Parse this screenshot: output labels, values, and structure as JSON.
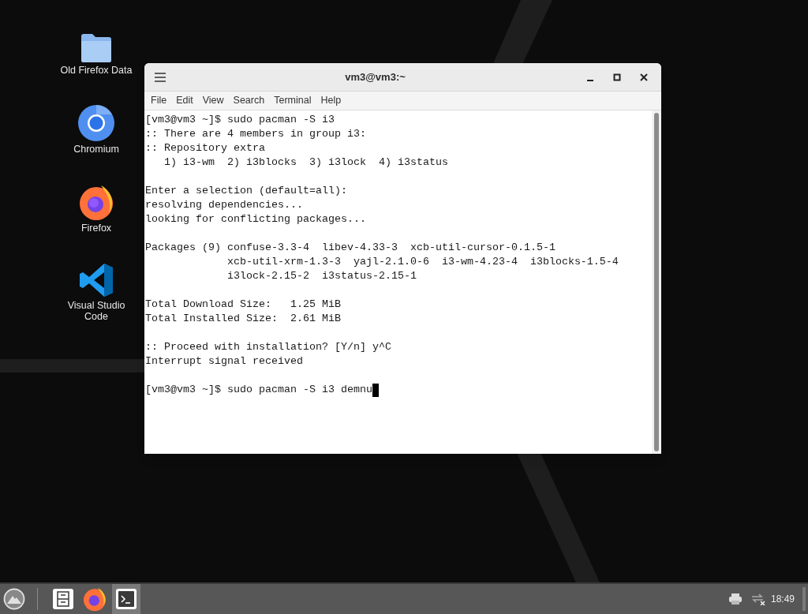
{
  "desktop_icons": [
    {
      "kind": "folder",
      "label": "Old Firefox Data"
    },
    {
      "kind": "chromium",
      "label": "Chromium"
    },
    {
      "kind": "firefox",
      "label": "Firefox"
    },
    {
      "kind": "vscode",
      "label": "Visual Studio Code"
    }
  ],
  "window": {
    "title": "vm3@vm3:~",
    "menu": [
      "File",
      "Edit",
      "View",
      "Search",
      "Terminal",
      "Help"
    ],
    "blocks": [
      [
        "[vm3@vm3 ~]$ sudo pacman -S i3",
        ":: There are 4 members in group i3:",
        ":: Repository extra",
        "   1) i3-wm  2) i3blocks  3) i3lock  4) i3status"
      ],
      [
        "Enter a selection (default=all):",
        "resolving dependencies...",
        "looking for conflicting packages..."
      ],
      [
        "Packages (9) confuse-3.3-4  libev-4.33-3  xcb-util-cursor-0.1.5-1",
        "             xcb-util-xrm-1.3-3  yajl-2.1.0-6  i3-wm-4.23-4  i3blocks-1.5-4",
        "             i3lock-2.15-2  i3status-2.15-1"
      ],
      [
        "Total Download Size:   1.25 MiB",
        "Total Installed Size:  2.61 MiB"
      ],
      [
        ":: Proceed with installation? [Y/n] y^C",
        "Interrupt signal received"
      ],
      [
        "[vm3@vm3 ~]$ sudo pacman -S i3 demnu"
      ]
    ],
    "cursor": true
  },
  "taskbar": {
    "apps": [
      {
        "kind": "files",
        "selected": false
      },
      {
        "kind": "firefox",
        "selected": false
      },
      {
        "kind": "terminal",
        "selected": true
      }
    ],
    "clock": "18:49"
  }
}
